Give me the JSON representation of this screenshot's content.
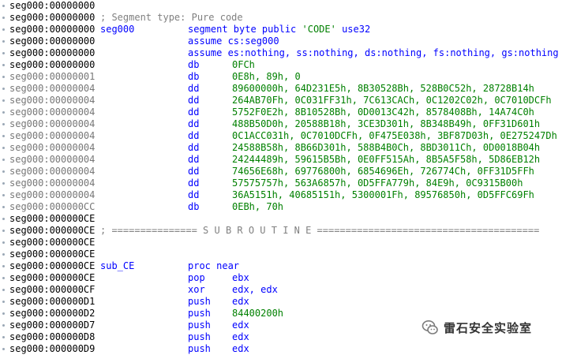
{
  "listing": [
    {
      "addr": "seg000:00000000",
      "kind": "blank"
    },
    {
      "addr": "seg000:00000000",
      "kind": "comment",
      "text": "; Segment type: Pure code"
    },
    {
      "addr": "seg000:00000000",
      "kind": "segdef",
      "label": "seg000",
      "mnem": "segment byte public ",
      "str": "'CODE'",
      "rest": " use32"
    },
    {
      "addr": "seg000:00000000",
      "kind": "full",
      "text": "assume cs:seg000"
    },
    {
      "addr": "seg000:00000000",
      "kind": "full",
      "text": "assume es:nothing, ss:nothing, ds:nothing, fs:nothing, gs:nothing"
    },
    {
      "addr": "seg000:00000000",
      "kind": "ins",
      "mnem": "db",
      "ops": "0FCh"
    },
    {
      "addr": "seg000:00000001",
      "kind": "ins",
      "mnem": "db",
      "ops": "0E8h, 89h, 0",
      "gray": true
    },
    {
      "addr": "seg000:00000004",
      "kind": "ins",
      "mnem": "dd",
      "ops": "89600000h, 64D231E5h, 8B30528Bh, 528B0C52h, 28728B14h",
      "gray": true
    },
    {
      "addr": "seg000:00000004",
      "kind": "ins",
      "mnem": "dd",
      "ops": "264AB70Fh, 0C031FF31h, 7C613CACh, 0C1202C02h, 0C7010DCFh",
      "gray": true
    },
    {
      "addr": "seg000:00000004",
      "kind": "ins",
      "mnem": "dd",
      "ops": "5752F0E2h, 8B10528Bh, 0D0013C42h, 8578408Bh, 14A74C0h",
      "gray": true
    },
    {
      "addr": "seg000:00000004",
      "kind": "ins",
      "mnem": "dd",
      "ops": "488B50D0h, 20588B18h, 3CE3D301h, 8B348B49h, 0FF31D601h",
      "gray": true
    },
    {
      "addr": "seg000:00000004",
      "kind": "ins",
      "mnem": "dd",
      "ops": "0C1ACC031h, 0C7010DCFh, 0F475E038h, 3BF87D03h, 0E275247Dh",
      "gray": true
    },
    {
      "addr": "seg000:00000004",
      "kind": "ins",
      "mnem": "dd",
      "ops": "24588B58h, 8B66D301h, 588B4B0Ch, 8BD3011Ch, 0D0018B04h",
      "gray": true
    },
    {
      "addr": "seg000:00000004",
      "kind": "ins",
      "mnem": "dd",
      "ops": "24244489h, 59615B5Bh, 0E0FF515Ah, 8B5A5F58h, 5D86EB12h",
      "gray": true
    },
    {
      "addr": "seg000:00000004",
      "kind": "ins",
      "mnem": "dd",
      "ops": "74656E68h, 69776800h, 6854696Eh, 726774Ch, 0FF31D5FFh",
      "gray": true
    },
    {
      "addr": "seg000:00000004",
      "kind": "ins",
      "mnem": "dd",
      "ops": "57575757h, 563A6857h, 0D5FFA779h, 84E9h, 0C9315B00h",
      "gray": true
    },
    {
      "addr": "seg000:00000004",
      "kind": "ins",
      "mnem": "dd",
      "ops": "36A5151h, 40685151h, 5300001Fh, 89576850h, 0D5FFC69Fh",
      "gray": true
    },
    {
      "addr": "seg000:000000CC",
      "kind": "ins",
      "mnem": "db",
      "ops": "0EBh, 70h",
      "gray": true
    },
    {
      "addr": "seg000:000000CE",
      "kind": "blank"
    },
    {
      "addr": "seg000:000000CE",
      "kind": "comment",
      "text": "; =============== S U B R O U T I N E ======================================="
    },
    {
      "addr": "seg000:000000CE",
      "kind": "blank"
    },
    {
      "addr": "seg000:000000CE",
      "kind": "blank"
    },
    {
      "addr": "seg000:000000CE",
      "kind": "proc",
      "label": "sub_CE",
      "mnem": "proc near"
    },
    {
      "addr": "seg000:000000CE",
      "kind": "ins",
      "mnem": "pop",
      "ops": "ebx"
    },
    {
      "addr": "seg000:000000CF",
      "kind": "ins",
      "mnem": "xor",
      "ops": "edx, edx"
    },
    {
      "addr": "seg000:000000D1",
      "kind": "ins",
      "mnem": "push",
      "ops": "edx"
    },
    {
      "addr": "seg000:000000D2",
      "kind": "ins",
      "mnem": "push",
      "ops": "84400200h",
      "num": true
    },
    {
      "addr": "seg000:000000D7",
      "kind": "ins",
      "mnem": "push",
      "ops": "edx"
    },
    {
      "addr": "seg000:000000D8",
      "kind": "ins",
      "mnem": "push",
      "ops": "edx"
    },
    {
      "addr": "seg000:000000D9",
      "kind": "ins",
      "mnem": "push",
      "ops": "edx"
    }
  ],
  "watermark": {
    "text": "雷石安全实验室",
    "icon": "wechat-icon"
  }
}
